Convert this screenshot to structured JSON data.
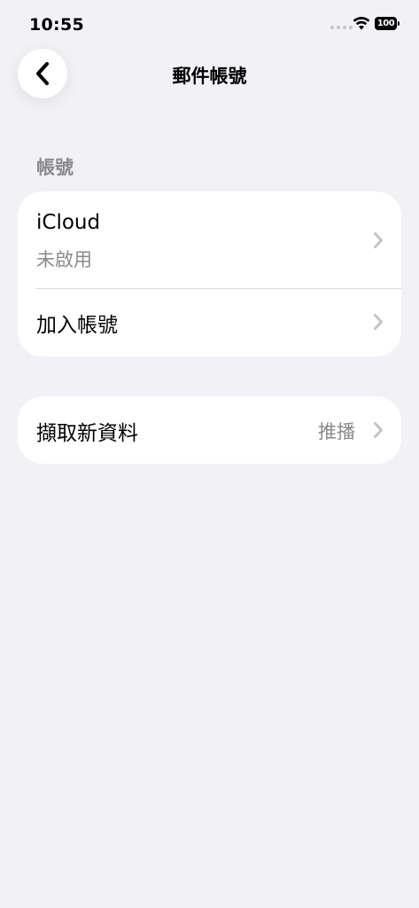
{
  "status_bar": {
    "time": "10:55",
    "battery": "100"
  },
  "nav": {
    "title": "郵件帳號",
    "back_icon": "chevron-left-icon"
  },
  "accounts_section": {
    "header": "帳號",
    "items": [
      {
        "title": "iCloud",
        "subtitle": "未啟用"
      },
      {
        "title": "加入帳號"
      }
    ]
  },
  "fetch_section": {
    "title": "擷取新資料",
    "value": "推播"
  },
  "colors": {
    "background": "#f2f1f6",
    "card": "#ffffff",
    "secondary_text": "#8a8a8e",
    "chevron": "#c4c4c8"
  }
}
